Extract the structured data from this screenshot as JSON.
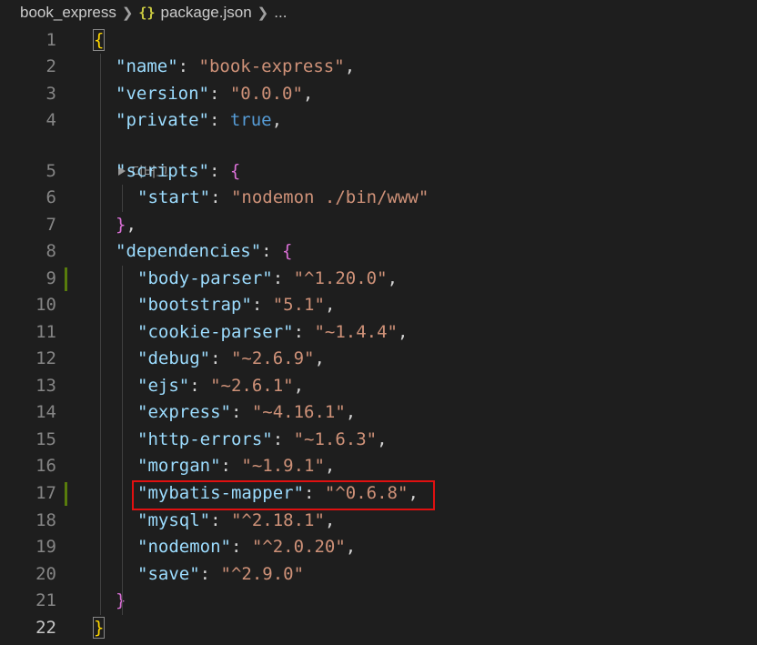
{
  "breadcrumb": {
    "folder": "book_express",
    "file_icon": "{}",
    "file": "package.json",
    "ellipsis": "..."
  },
  "codelens": {
    "label": "디버그"
  },
  "lines": [
    {
      "n": "1",
      "indent": 0,
      "tokens": [
        {
          "t": "{",
          "c": "brace-y match-brace"
        }
      ]
    },
    {
      "n": "2",
      "indent": 1,
      "tokens": [
        {
          "t": "\"name\"",
          "c": "key"
        },
        {
          "t": ": ",
          "c": "punc"
        },
        {
          "t": "\"book-express\"",
          "c": "str"
        },
        {
          "t": ",",
          "c": "punc"
        }
      ]
    },
    {
      "n": "3",
      "indent": 1,
      "tokens": [
        {
          "t": "\"version\"",
          "c": "key"
        },
        {
          "t": ": ",
          "c": "punc"
        },
        {
          "t": "\"0.0.0\"",
          "c": "str"
        },
        {
          "t": ",",
          "c": "punc"
        }
      ]
    },
    {
      "n": "4",
      "indent": 1,
      "tokens": [
        {
          "t": "\"private\"",
          "c": "key"
        },
        {
          "t": ": ",
          "c": "punc"
        },
        {
          "t": "true",
          "c": "kw"
        },
        {
          "t": ",",
          "c": "punc"
        }
      ]
    },
    {
      "n": "5",
      "indent": 1,
      "tokens": [
        {
          "t": "\"scripts\"",
          "c": "key"
        },
        {
          "t": ": ",
          "c": "punc"
        },
        {
          "t": "{",
          "c": "brace-p"
        }
      ]
    },
    {
      "n": "6",
      "indent": 2,
      "tokens": [
        {
          "t": "\"start\"",
          "c": "key"
        },
        {
          "t": ": ",
          "c": "punc"
        },
        {
          "t": "\"nodemon ./bin/www\"",
          "c": "str"
        }
      ]
    },
    {
      "n": "7",
      "indent": 1,
      "tokens": [
        {
          "t": "}",
          "c": "brace-p"
        },
        {
          "t": ",",
          "c": "punc"
        }
      ]
    },
    {
      "n": "8",
      "indent": 1,
      "tokens": [
        {
          "t": "\"dependencies\"",
          "c": "key"
        },
        {
          "t": ": ",
          "c": "punc"
        },
        {
          "t": "{",
          "c": "brace-p"
        }
      ]
    },
    {
      "n": "9",
      "indent": 2,
      "mark": true,
      "tokens": [
        {
          "t": "\"body-parser\"",
          "c": "key"
        },
        {
          "t": ": ",
          "c": "punc"
        },
        {
          "t": "\"^1.20.0\"",
          "c": "str"
        },
        {
          "t": ",",
          "c": "punc"
        }
      ]
    },
    {
      "n": "10",
      "indent": 2,
      "tokens": [
        {
          "t": "\"bootstrap\"",
          "c": "key"
        },
        {
          "t": ": ",
          "c": "punc"
        },
        {
          "t": "\"5.1\"",
          "c": "str"
        },
        {
          "t": ",",
          "c": "punc"
        }
      ]
    },
    {
      "n": "11",
      "indent": 2,
      "tokens": [
        {
          "t": "\"cookie-parser\"",
          "c": "key"
        },
        {
          "t": ": ",
          "c": "punc"
        },
        {
          "t": "\"~1.4.4\"",
          "c": "str"
        },
        {
          "t": ",",
          "c": "punc"
        }
      ]
    },
    {
      "n": "12",
      "indent": 2,
      "tokens": [
        {
          "t": "\"debug\"",
          "c": "key"
        },
        {
          "t": ": ",
          "c": "punc"
        },
        {
          "t": "\"~2.6.9\"",
          "c": "str"
        },
        {
          "t": ",",
          "c": "punc"
        }
      ]
    },
    {
      "n": "13",
      "indent": 2,
      "tokens": [
        {
          "t": "\"ejs\"",
          "c": "key"
        },
        {
          "t": ": ",
          "c": "punc"
        },
        {
          "t": "\"~2.6.1\"",
          "c": "str"
        },
        {
          "t": ",",
          "c": "punc"
        }
      ]
    },
    {
      "n": "14",
      "indent": 2,
      "tokens": [
        {
          "t": "\"express\"",
          "c": "key"
        },
        {
          "t": ": ",
          "c": "punc"
        },
        {
          "t": "\"~4.16.1\"",
          "c": "str"
        },
        {
          "t": ",",
          "c": "punc"
        }
      ]
    },
    {
      "n": "15",
      "indent": 2,
      "tokens": [
        {
          "t": "\"http-errors\"",
          "c": "key"
        },
        {
          "t": ": ",
          "c": "punc"
        },
        {
          "t": "\"~1.6.3\"",
          "c": "str"
        },
        {
          "t": ",",
          "c": "punc"
        }
      ]
    },
    {
      "n": "16",
      "indent": 2,
      "tokens": [
        {
          "t": "\"morgan\"",
          "c": "key"
        },
        {
          "t": ": ",
          "c": "punc"
        },
        {
          "t": "\"~1.9.1\"",
          "c": "str"
        },
        {
          "t": ",",
          "c": "punc"
        }
      ]
    },
    {
      "n": "17",
      "indent": 2,
      "mark": true,
      "tokens": [
        {
          "t": "\"mybatis-mapper\"",
          "c": "key"
        },
        {
          "t": ": ",
          "c": "punc"
        },
        {
          "t": "\"^0.6.8\"",
          "c": "str"
        },
        {
          "t": ",",
          "c": "punc"
        }
      ]
    },
    {
      "n": "18",
      "indent": 2,
      "tokens": [
        {
          "t": "\"mysql\"",
          "c": "key"
        },
        {
          "t": ": ",
          "c": "punc"
        },
        {
          "t": "\"^2.18.1\"",
          "c": "str"
        },
        {
          "t": ",",
          "c": "punc"
        }
      ]
    },
    {
      "n": "19",
      "indent": 2,
      "tokens": [
        {
          "t": "\"nodemon\"",
          "c": "key"
        },
        {
          "t": ": ",
          "c": "punc"
        },
        {
          "t": "\"^2.0.20\"",
          "c": "str"
        },
        {
          "t": ",",
          "c": "punc"
        }
      ]
    },
    {
      "n": "20",
      "indent": 2,
      "tokens": [
        {
          "t": "\"save\"",
          "c": "key"
        },
        {
          "t": ": ",
          "c": "punc"
        },
        {
          "t": "\"^2.9.0\"",
          "c": "str"
        }
      ]
    },
    {
      "n": "21",
      "indent": 1,
      "tokens": [
        {
          "t": "}",
          "c": "brace-p"
        }
      ]
    },
    {
      "n": "22",
      "indent": 0,
      "active": true,
      "tokens": [
        {
          "t": "}",
          "c": "brace-y match-brace"
        }
      ]
    }
  ],
  "colors": {
    "background": "#1e1e1e",
    "key": "#9cdcfe",
    "string": "#ce9178",
    "keyword": "#569cd6",
    "highlight_box": "#e01010",
    "git_modified_mark": "#587c0c"
  }
}
